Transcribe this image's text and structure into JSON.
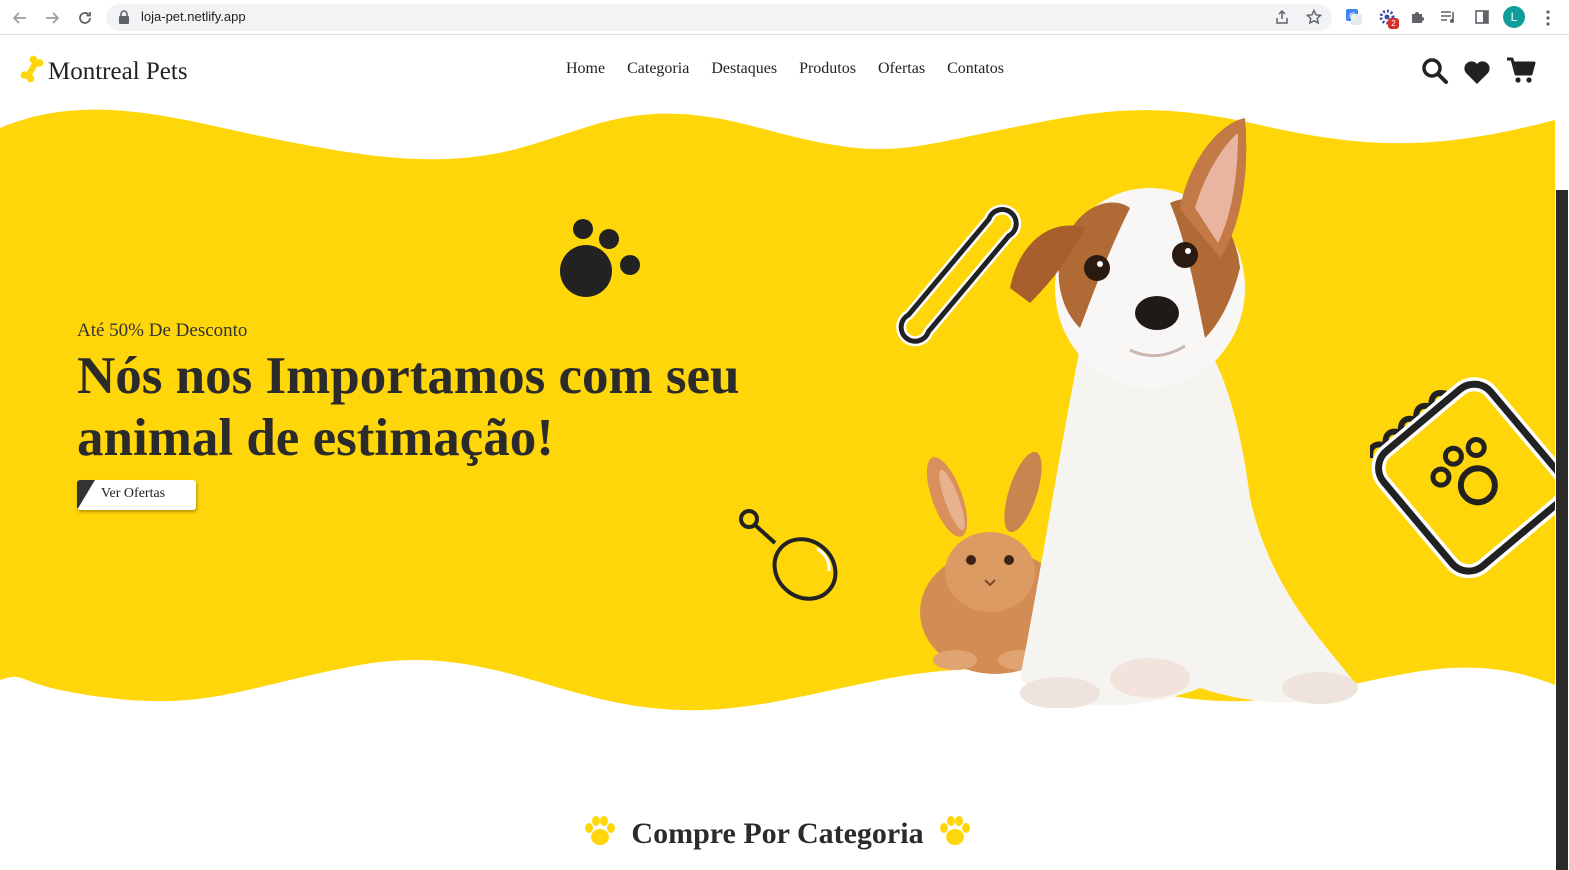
{
  "browser": {
    "url": "loja-pet.netlify.app",
    "profile_initial": "L",
    "extension_badge": "2"
  },
  "header": {
    "logo_text": "Montreal Pets",
    "nav": [
      "Home",
      "Categoria",
      "Destaques",
      "Produtos",
      "Ofertas",
      "Contatos"
    ],
    "icons": [
      "search-icon",
      "heart-icon",
      "cart-icon"
    ]
  },
  "hero": {
    "subtitle": "Até 50% De Desconto",
    "title": "Nós nos Importamos com seu animal de estimação!",
    "button_label": "Ver Ofertas"
  },
  "section": {
    "title": "Compre Por Categoria"
  },
  "colors": {
    "accent": "#FFD60A",
    "dark": "#2B2B2B"
  }
}
